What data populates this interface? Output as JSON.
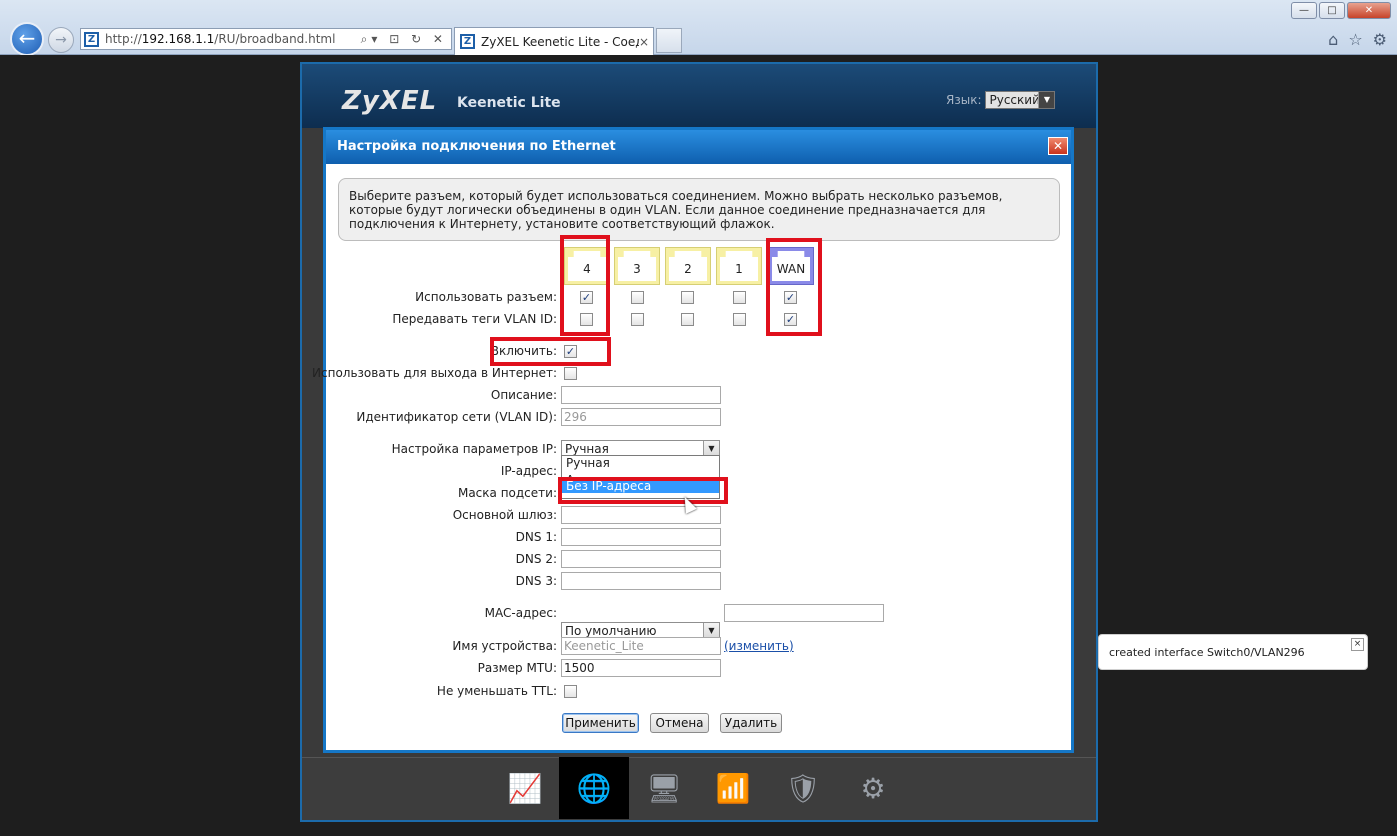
{
  "browser": {
    "url_prefix": "http://",
    "url_host": "192.168.1.1",
    "url_path": "/RU/broadband.html",
    "tab_title": "ZyXEL Keenetic Lite - Соед...",
    "tab_close": "×",
    "win_min": "—",
    "win_max": "□",
    "win_close": "✕"
  },
  "header": {
    "logo": "ZyXEL",
    "model": "Keenetic Lite",
    "lang_label": "Язык:",
    "lang_value": "Русский"
  },
  "dialog": {
    "title": "Настройка подключения по Ethernet",
    "close": "✕",
    "info": "Выберите разъем, который будет использоваться соединением. Можно выбрать несколько разъемов, которые будут логически объединены в один VLAN. Если данное соединение предназначается для подключения к Интернету, установите соответствующий флажок.",
    "ports": [
      "4",
      "3",
      "2",
      "1",
      "WAN"
    ],
    "use_port_label": "Использовать разъем:",
    "vlan_tag_label": "Передавать теги VLAN ID:",
    "enable_label": "Включить:",
    "internet_label": "Использовать для выхода в Интернет:",
    "desc_label": "Описание:",
    "vlan_id_label": "Идентификатор сети (VLAN ID):",
    "vlan_id_value": "296",
    "ip_mode_label": "Настройка параметров IP:",
    "ip_mode_value": "Ручная",
    "ip_options": [
      "Ручная",
      "Автоматическая",
      "Без IP-адреса"
    ],
    "ip_label": "IP-адрес:",
    "mask_label": "Маска подсети:",
    "gw_label": "Основной шлюз:",
    "dns1_label": "DNS 1:",
    "dns2_label": "DNS 2:",
    "dns3_label": "DNS 3:",
    "mac_label": "MAC-адрес:",
    "mac_value": "По умолчанию",
    "hostname_label": "Имя устройства:",
    "hostname_value": "Keenetic_Lite",
    "hostname_link": "(изменить)",
    "mtu_label": "Размер MTU:",
    "mtu_value": "1500",
    "ttl_label": "Не уменьшать TTL:",
    "apply": "Применить",
    "cancel": "Отмена",
    "delete": "Удалить"
  },
  "checks": {
    "use": [
      true,
      false,
      false,
      false,
      true
    ],
    "tag": [
      false,
      false,
      false,
      false,
      true
    ],
    "enable": true,
    "internet": false,
    "ttl": false
  },
  "toast": {
    "text": "created interface Switch0/VLAN296",
    "close": "×"
  },
  "nav": [
    "monitor-icon",
    "globe-icon",
    "network-icon",
    "wifi-signal-icon",
    "shield-icon",
    "gear-icon"
  ]
}
